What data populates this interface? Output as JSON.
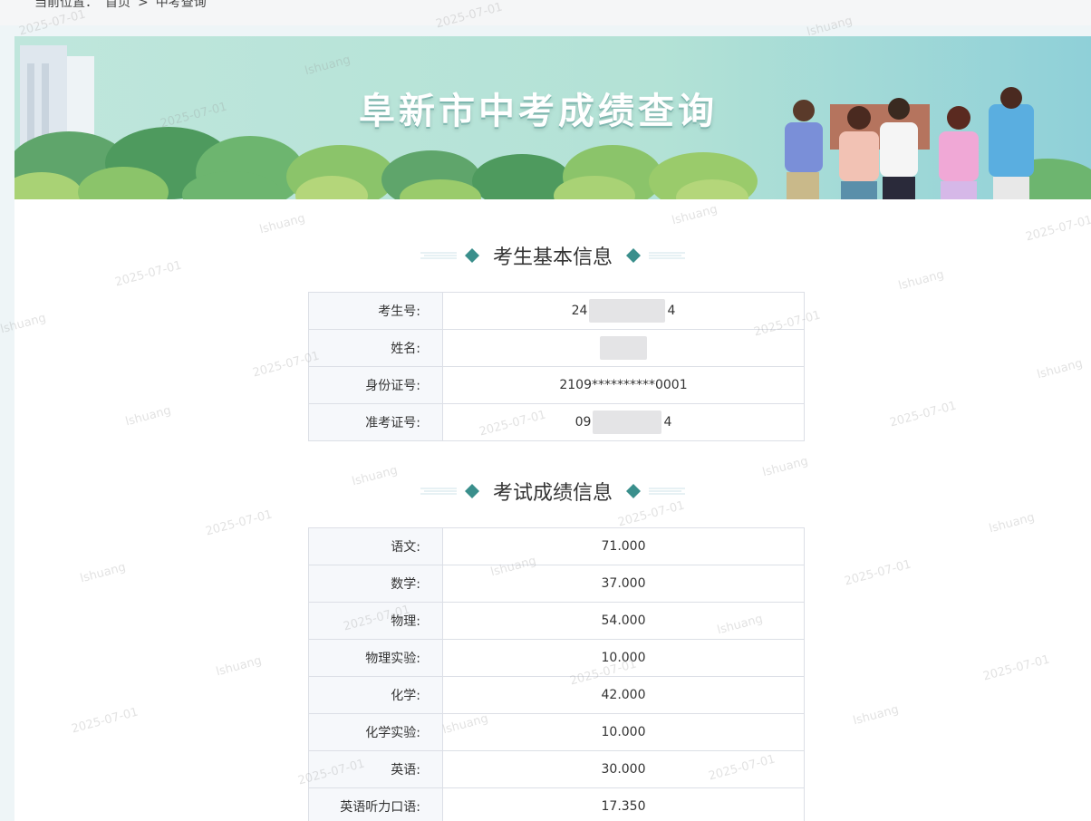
{
  "breadcrumb": {
    "prefix": "当前位置：",
    "home": "首页",
    "sep": ">",
    "current": "中考查询"
  },
  "banner": {
    "title": "阜新市中考成绩查询"
  },
  "basic": {
    "title": "考生基本信息",
    "rows": [
      {
        "label": "考生号:",
        "value_start": "24",
        "value_end": "4"
      },
      {
        "label": "姓名:",
        "value": ""
      },
      {
        "label": "身份证号:",
        "value": "2109**********0001"
      },
      {
        "label": "准考证号:",
        "value_start": "09",
        "value_end": "4"
      }
    ]
  },
  "scores": {
    "title": "考试成绩信息",
    "rows": [
      {
        "label": "语文:",
        "value": "71.000"
      },
      {
        "label": "数学:",
        "value": "37.000"
      },
      {
        "label": "物理:",
        "value": "54.000"
      },
      {
        "label": "物理实验:",
        "value": "10.000"
      },
      {
        "label": "化学:",
        "value": "42.000"
      },
      {
        "label": "化学实验:",
        "value": "10.000"
      },
      {
        "label": "英语:",
        "value": "30.000"
      },
      {
        "label": "英语听力口语:",
        "value": "17.350"
      }
    ]
  },
  "watermark": {
    "text1": "2025-07-01",
    "text2": "lshuang"
  },
  "colors": {
    "accent": "#3a8f8c",
    "border": "#dcdfe6",
    "label_bg": "#f6f8fb"
  }
}
